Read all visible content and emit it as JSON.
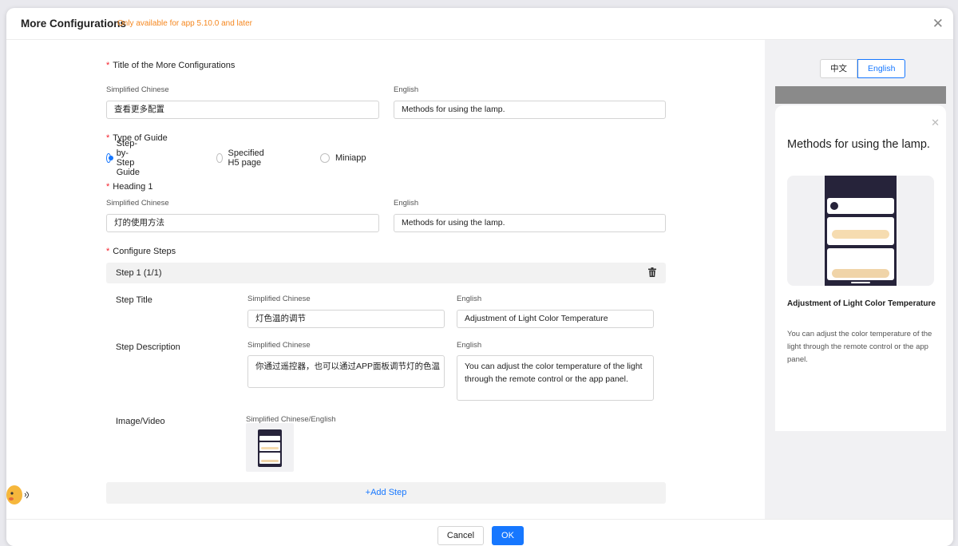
{
  "modal": {
    "title": "More Configurations",
    "note": "Only available for app 5.10.0 and later",
    "close_icon": "close-icon"
  },
  "form": {
    "title_section": {
      "label": "Title of the More Configurations",
      "zh_label": "Simplified Chinese",
      "en_label": "English",
      "zh_value": "查看更多配置",
      "en_value": "Methods for using the lamp."
    },
    "guide_type": {
      "label": "Type of Guide",
      "options": [
        "Step-by-Step Guide",
        "Specified H5 page",
        "Miniapp"
      ],
      "selected": "Step-by-Step Guide"
    },
    "heading1": {
      "label": "Heading 1",
      "zh_label": "Simplified Chinese",
      "en_label": "English",
      "zh_value": "灯的使用方法",
      "en_value": "Methods for using the lamp."
    },
    "steps": {
      "label": "Configure Steps",
      "step_header": "Step 1 (1/1)",
      "delete_icon": "trash-icon",
      "step_title": {
        "label": "Step Title",
        "zh_label": "Simplified Chinese",
        "en_label": "English",
        "zh_value": "灯色温的调节",
        "en_value": "Adjustment of Light Color Temperature"
      },
      "step_description": {
        "label": "Step Description",
        "zh_label": "Simplified Chinese",
        "en_label": "English",
        "zh_value": "你通过遥控器，也可以通过APP面板调节灯的色温",
        "en_value": "You can adjust the color temperature of the light through the remote control or the app panel."
      },
      "image_video": {
        "label": "Image/Video",
        "sublabel": "Simplified Chinese/English"
      },
      "add_step": "+Add Step"
    }
  },
  "preview": {
    "lang_options": [
      "中文",
      "English"
    ],
    "selected_lang": "English",
    "sheet_title": "Methods for using the lamp.",
    "step_title": "Adjustment of Light Color Temperature",
    "step_description": "You can adjust the color temperature of the light through the remote control or the app panel."
  },
  "footer": {
    "cancel": "Cancel",
    "ok": "OK"
  },
  "colors": {
    "primary": "#1677ff",
    "note": "#f5871f",
    "required": "#f5222d"
  }
}
